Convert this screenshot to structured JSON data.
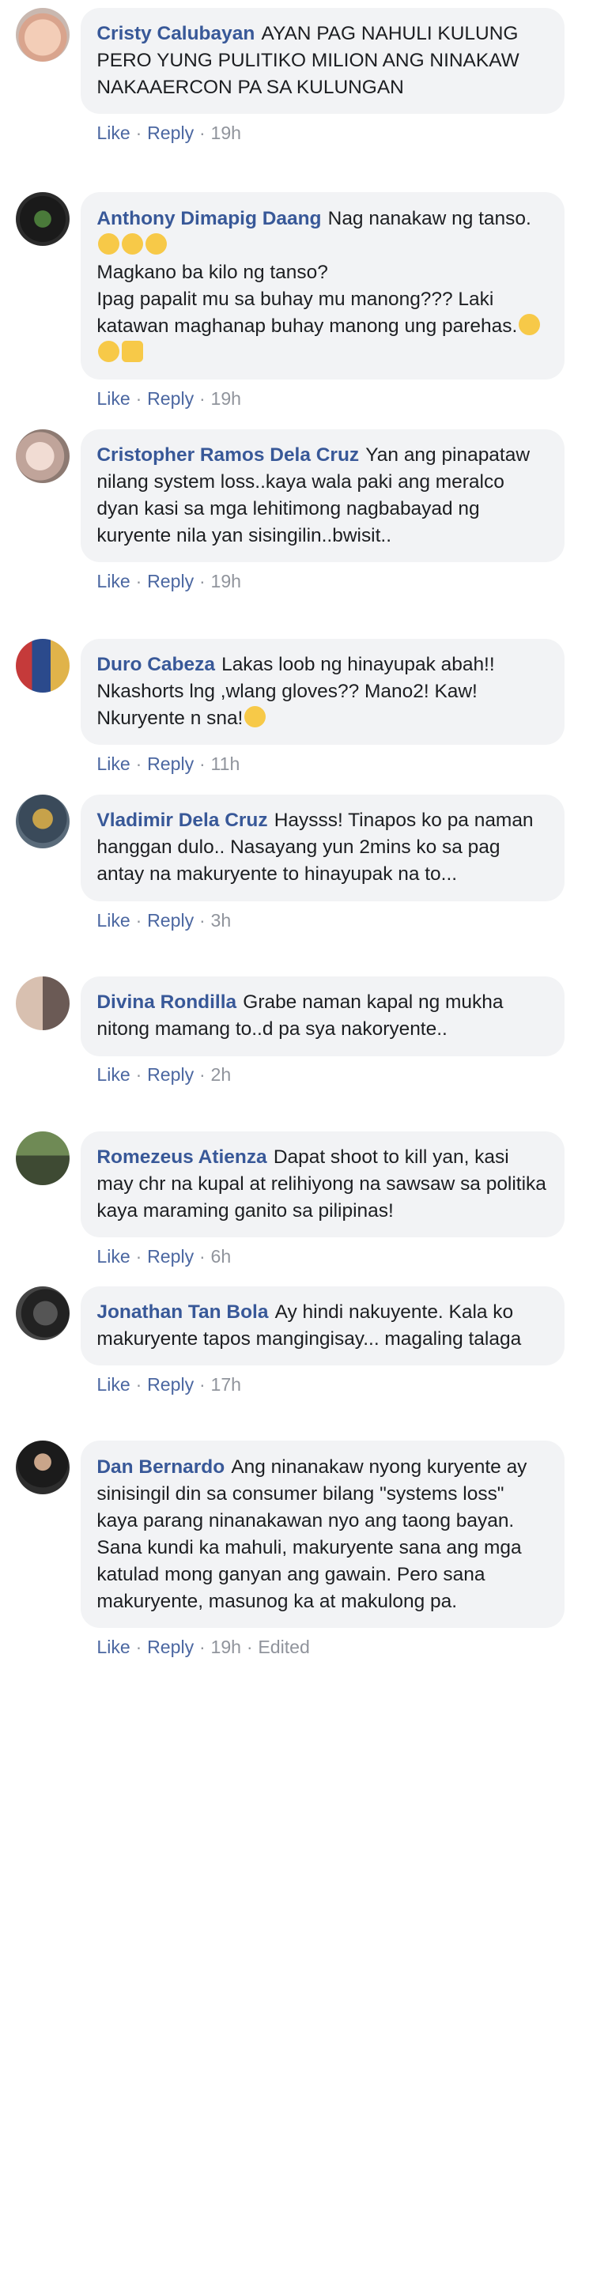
{
  "actions": {
    "like": "Like",
    "reply": "Reply",
    "dot": "·"
  },
  "colors": {
    "name": "#385898",
    "link": "#4b67a1",
    "meta": "#90949c",
    "bubble": "#f2f3f5"
  },
  "comments": [
    {
      "author": "Cristy Calubayan",
      "text": "AYAN PAG NAHULI KULUNG PERO YUNG PULITIKO MILION ANG NINAKAW NAKAAERCON PA SA KULUNGAN",
      "time": "19h"
    },
    {
      "author": "Anthony Dimapig Daang",
      "text_lines": [
        "Nag nanakaw ng tanso.",
        "Magkano ba kilo ng tanso?",
        "Ipag papalit mu sa buhay mu manong??? Laki katawan maghanap buhay manong ung parehas."
      ],
      "emoji": [
        "grinning-sweat-emoji",
        "grinning-sweat-emoji",
        "grinning-sweat-emoji",
        "face-with-hand-emoji",
        "face-with-hand-emoji",
        "fist-bump-emoji"
      ],
      "time": "19h"
    },
    {
      "author": "Cristopher Ramos Dela Cruz",
      "text": "Yan ang pinapataw nilang system loss..kaya wala paki ang meralco dyan kasi sa mga lehitimong nagbabayad ng kuryente nila yan sisingilin..bwisit..",
      "time": "19h"
    },
    {
      "author": "Duro Cabeza",
      "text": "Lakas loob ng hinayupak abah!! Nkashorts lng ,wlang gloves?? Mano2! Kaw! Nkuryente n sna!",
      "emoji": [
        "neutral-face-emoji"
      ],
      "time": "11h"
    },
    {
      "author": "Vladimir Dela Cruz",
      "text": "Haysss! Tinapos ko pa naman hanggan dulo.. Nasayang yun 2mins ko sa pag antay na makuryente to hinayupak na to...",
      "time": "3h"
    },
    {
      "author": "Divina Rondilla",
      "text": "Grabe naman kapal ng mukha nitong mamang to..d pa sya nakoryente..",
      "time": "2h"
    },
    {
      "author": "Romezeus Atienza",
      "text": "Dapat shoot to kill yan, kasi may chr na kupal at relihiyong na sawsaw sa politika kaya maraming ganito sa pilipinas!",
      "time": "6h"
    },
    {
      "author": "Jonathan Tan Bola",
      "text": "Ay hindi nakuyente. Kala ko makuryente tapos mangingisay... magaling talaga",
      "time": "17h"
    },
    {
      "author": "Dan Bernardo",
      "text": "Ang ninanakaw nyong kuryente ay sinisingil din sa consumer bilang \"systems loss\" kaya parang ninanakawan nyo ang taong bayan. Sana kundi ka mahuli, makuryente sana ang mga katulad mong ganyan ang gawain. Pero sana makuryente, masunog ka at makulong pa.",
      "time": "19h",
      "edited": "Edited"
    }
  ]
}
